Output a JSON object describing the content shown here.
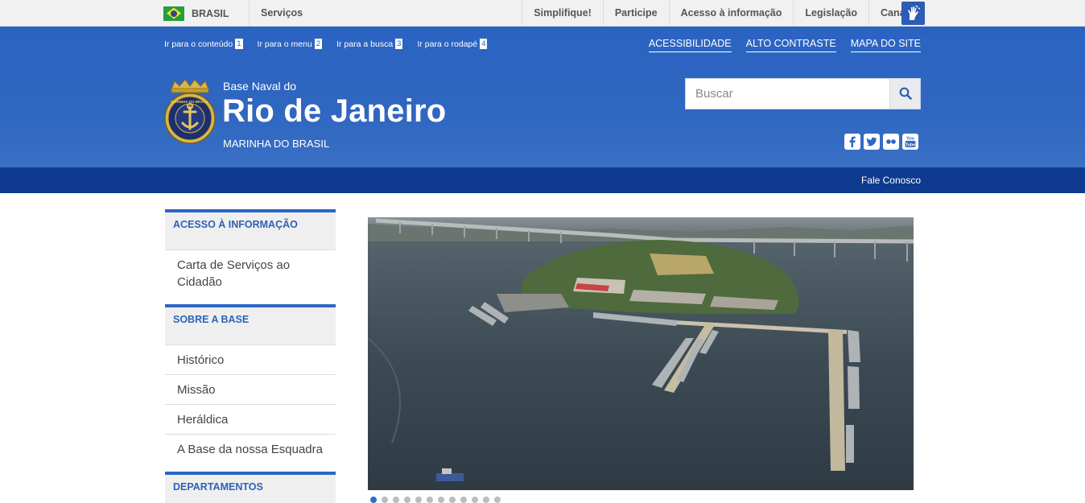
{
  "gov_bar": {
    "brasil_label": "BRASIL",
    "servicos_label": "Serviços",
    "links": [
      "Simplifique!",
      "Participe",
      "Acesso à informação",
      "Legislação",
      "Canais"
    ]
  },
  "header": {
    "skip_links": [
      {
        "label": "Ir para o conteúdo",
        "key": "1"
      },
      {
        "label": "Ir para o menu",
        "key": "2"
      },
      {
        "label": "Ir para a busca",
        "key": "3"
      },
      {
        "label": "Ir para o rodapé",
        "key": "4"
      }
    ],
    "top_links": [
      "ACESSIBILIDADE",
      "ALTO CONTRASTE",
      "MAPA DO SITE"
    ],
    "site_pretitle": "Base Naval do",
    "site_title": "Rio de Janeiro",
    "site_subtitle": "MARINHA DO BRASIL",
    "emblem_text": "MARINHA DO BRASIL",
    "search": {
      "placeholder": "Buscar"
    },
    "social_icons": [
      "facebook-icon",
      "twitter-icon",
      "flickr-icon",
      "youtube-icon"
    ]
  },
  "subnav": {
    "fale_conosco": "Fale Conosco"
  },
  "sidebar": {
    "sections": [
      {
        "title": "ACESSO À INFORMAÇÃO",
        "items": [
          "Carta de Serviços ao Cidadão"
        ]
      },
      {
        "title": "SOBRE A BASE",
        "items": [
          "Histórico",
          "Missão",
          "Heráldica",
          "A Base da nossa Esquadra"
        ]
      },
      {
        "title": "DEPARTAMENTOS",
        "items": []
      }
    ]
  },
  "carousel": {
    "image_description": "aerial-photo-naval-base",
    "slide_count": 12,
    "active_slide": 1
  },
  "colors": {
    "header_blue": "#2f66c0",
    "subnav_blue": "#0e3a8f",
    "sidebar_accent": "#2c66c4"
  }
}
